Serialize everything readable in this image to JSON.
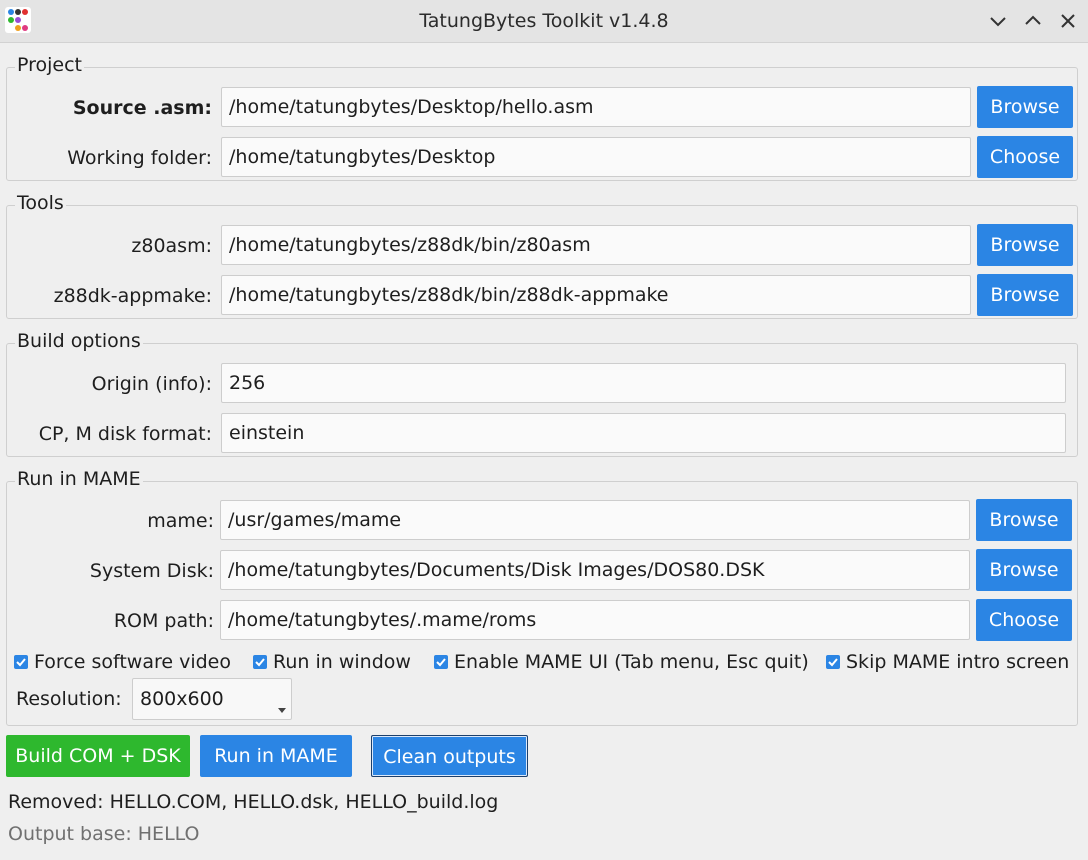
{
  "window": {
    "title": "TatungBytes Toolkit v1.4.8",
    "controls": [
      "minimize",
      "maximize",
      "close"
    ]
  },
  "project": {
    "title": "Project",
    "source_label": "Source .asm:",
    "source_value": "/home/tatungbytes/Desktop/hello.asm",
    "source_button": "Browse",
    "working_label": "Working folder:",
    "working_value": "/home/tatungbytes/Desktop",
    "working_button": "Choose"
  },
  "tools": {
    "title": "Tools",
    "z80asm_label": "z80asm:",
    "z80asm_value": "/home/tatungbytes/z88dk/bin/z80asm",
    "z80asm_button": "Browse",
    "appmake_label": "z88dk-appmake:",
    "appmake_value": "/home/tatungbytes/z88dk/bin/z88dk-appmake",
    "appmake_button": "Browse"
  },
  "build": {
    "title": "Build options",
    "origin_label": "Origin (info):",
    "origin_value": "256",
    "format_label": "CP, M disk format:",
    "format_value": "einstein"
  },
  "mame": {
    "title": "Run in MAME",
    "mame_label": "mame:",
    "mame_value": "/usr/games/mame",
    "mame_button": "Browse",
    "disk_label": "System Disk:",
    "disk_value": "/home/tatungbytes/Documents/Disk Images/DOS80.DSK",
    "disk_button": "Browse",
    "rom_label": "ROM path:",
    "rom_value": "/home/tatungbytes/.mame/roms",
    "rom_button": "Choose",
    "options": [
      {
        "label": "Force software video",
        "checked": true
      },
      {
        "label": "Run in window",
        "checked": true
      },
      {
        "label": "Enable MAME UI (Tab menu, Esc quit)",
        "checked": true
      },
      {
        "label": "Skip MAME intro screen",
        "checked": true
      }
    ],
    "resolution_label": "Resolution:",
    "resolution_value": "800x600"
  },
  "actions": {
    "build": "Build COM + DSK",
    "run": "Run in MAME",
    "clean": "Clean outputs"
  },
  "status": {
    "message": "Removed: HELLO.COM, HELLO.dsk, HELLO_build.log",
    "output_base": "Output base: HELLO"
  },
  "colors": {
    "accent": "#2b85e4",
    "build": "#2eb82e",
    "muted_text": "#707070"
  }
}
